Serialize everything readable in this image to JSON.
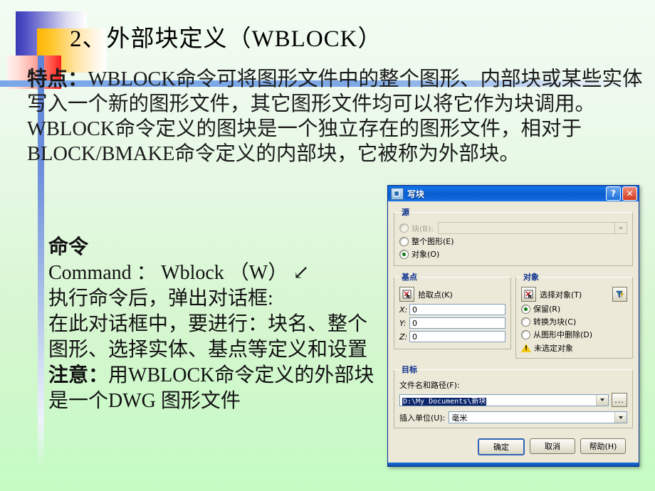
{
  "slide": {
    "title": "2、外部块定义（WBLOCK）",
    "paragraph_label": "特点：",
    "paragraph_body": "WBLOCK命令可将图形文件中的整个图形、内部块或某些实体写入一个新的图形文件，其它图形文件均可以将它作为块调用。WBLOCK命令定义的图块是一个独立存在的图形文件，相对于BLOCK/BMAKE命令定义的内部块，它被称为外部块。",
    "command_heading": "命令",
    "command_line": "Command ： Wblock （W） ↙",
    "line_after_exec": "执行命令后，弹出对话框:",
    "line_dialog_steps": "在此对话框中，要进行：块名、整个图形、选择实体、基点等定义和设置",
    "note_label": "注意：",
    "note_body": "用WBLOCK命令定义的外部块是一个DWG 图形文件"
  },
  "dialog": {
    "title": "写块",
    "titlebar_buttons": {
      "help": "?",
      "close": "✕"
    },
    "source": {
      "legend": "源",
      "block_label": "块(B):",
      "block_value": "",
      "entire_drawing_label": "整个图形(E)",
      "objects_label": "对象(O)",
      "selected": "对象(O)"
    },
    "base_point": {
      "legend": "基点",
      "pick_point_label": "拾取点(K)",
      "x_label": "X:",
      "x_value": "0",
      "y_label": "Y:",
      "y_value": "0",
      "z_label": "Z:",
      "z_value": "0"
    },
    "objects": {
      "legend": "对象",
      "select_objects_label": "选择对象(T)",
      "retain_label": "保留(R)",
      "convert_to_block_label": "转换为块(C)",
      "delete_from_drawing_label": "从图形中删除(D)",
      "selected": "保留(R)",
      "status_text": "未选定对象"
    },
    "destination": {
      "legend": "目标",
      "filename_label": "文件名和路径(F):",
      "filename_value": "D:\\My Documents\\新块",
      "insert_units_label": "插入单位(U):",
      "insert_units_value": "毫米",
      "browse_label": "..."
    },
    "buttons": {
      "ok": "确定",
      "cancel": "取消",
      "help": "帮助(H)"
    }
  },
  "colors": {
    "titlebar_blue": "#0b5ed0",
    "dialog_face": "#ece9d8",
    "group_legend": "#0a2f8f",
    "selection_blue": "#0a246a",
    "warning_yellow": "#f2c70d",
    "slide_bg_top": "#f2fcf2",
    "slide_bg_bottom": "#c4fcc4",
    "rule_blue": "#7aa7e8"
  }
}
